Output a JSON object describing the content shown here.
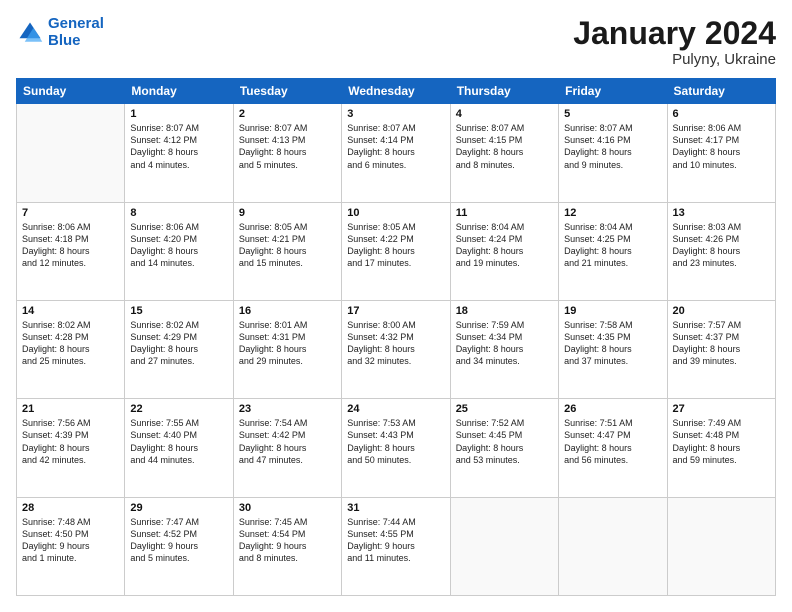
{
  "logo": {
    "line1": "General",
    "line2": "Blue"
  },
  "title": "January 2024",
  "subtitle": "Pulyny, Ukraine",
  "headers": [
    "Sunday",
    "Monday",
    "Tuesday",
    "Wednesday",
    "Thursday",
    "Friday",
    "Saturday"
  ],
  "weeks": [
    [
      {
        "day": "",
        "info": ""
      },
      {
        "day": "1",
        "info": "Sunrise: 8:07 AM\nSunset: 4:12 PM\nDaylight: 8 hours\nand 4 minutes."
      },
      {
        "day": "2",
        "info": "Sunrise: 8:07 AM\nSunset: 4:13 PM\nDaylight: 8 hours\nand 5 minutes."
      },
      {
        "day": "3",
        "info": "Sunrise: 8:07 AM\nSunset: 4:14 PM\nDaylight: 8 hours\nand 6 minutes."
      },
      {
        "day": "4",
        "info": "Sunrise: 8:07 AM\nSunset: 4:15 PM\nDaylight: 8 hours\nand 8 minutes."
      },
      {
        "day": "5",
        "info": "Sunrise: 8:07 AM\nSunset: 4:16 PM\nDaylight: 8 hours\nand 9 minutes."
      },
      {
        "day": "6",
        "info": "Sunrise: 8:06 AM\nSunset: 4:17 PM\nDaylight: 8 hours\nand 10 minutes."
      }
    ],
    [
      {
        "day": "7",
        "info": "Sunrise: 8:06 AM\nSunset: 4:18 PM\nDaylight: 8 hours\nand 12 minutes."
      },
      {
        "day": "8",
        "info": "Sunrise: 8:06 AM\nSunset: 4:20 PM\nDaylight: 8 hours\nand 14 minutes."
      },
      {
        "day": "9",
        "info": "Sunrise: 8:05 AM\nSunset: 4:21 PM\nDaylight: 8 hours\nand 15 minutes."
      },
      {
        "day": "10",
        "info": "Sunrise: 8:05 AM\nSunset: 4:22 PM\nDaylight: 8 hours\nand 17 minutes."
      },
      {
        "day": "11",
        "info": "Sunrise: 8:04 AM\nSunset: 4:24 PM\nDaylight: 8 hours\nand 19 minutes."
      },
      {
        "day": "12",
        "info": "Sunrise: 8:04 AM\nSunset: 4:25 PM\nDaylight: 8 hours\nand 21 minutes."
      },
      {
        "day": "13",
        "info": "Sunrise: 8:03 AM\nSunset: 4:26 PM\nDaylight: 8 hours\nand 23 minutes."
      }
    ],
    [
      {
        "day": "14",
        "info": "Sunrise: 8:02 AM\nSunset: 4:28 PM\nDaylight: 8 hours\nand 25 minutes."
      },
      {
        "day": "15",
        "info": "Sunrise: 8:02 AM\nSunset: 4:29 PM\nDaylight: 8 hours\nand 27 minutes."
      },
      {
        "day": "16",
        "info": "Sunrise: 8:01 AM\nSunset: 4:31 PM\nDaylight: 8 hours\nand 29 minutes."
      },
      {
        "day": "17",
        "info": "Sunrise: 8:00 AM\nSunset: 4:32 PM\nDaylight: 8 hours\nand 32 minutes."
      },
      {
        "day": "18",
        "info": "Sunrise: 7:59 AM\nSunset: 4:34 PM\nDaylight: 8 hours\nand 34 minutes."
      },
      {
        "day": "19",
        "info": "Sunrise: 7:58 AM\nSunset: 4:35 PM\nDaylight: 8 hours\nand 37 minutes."
      },
      {
        "day": "20",
        "info": "Sunrise: 7:57 AM\nSunset: 4:37 PM\nDaylight: 8 hours\nand 39 minutes."
      }
    ],
    [
      {
        "day": "21",
        "info": "Sunrise: 7:56 AM\nSunset: 4:39 PM\nDaylight: 8 hours\nand 42 minutes."
      },
      {
        "day": "22",
        "info": "Sunrise: 7:55 AM\nSunset: 4:40 PM\nDaylight: 8 hours\nand 44 minutes."
      },
      {
        "day": "23",
        "info": "Sunrise: 7:54 AM\nSunset: 4:42 PM\nDaylight: 8 hours\nand 47 minutes."
      },
      {
        "day": "24",
        "info": "Sunrise: 7:53 AM\nSunset: 4:43 PM\nDaylight: 8 hours\nand 50 minutes."
      },
      {
        "day": "25",
        "info": "Sunrise: 7:52 AM\nSunset: 4:45 PM\nDaylight: 8 hours\nand 53 minutes."
      },
      {
        "day": "26",
        "info": "Sunrise: 7:51 AM\nSunset: 4:47 PM\nDaylight: 8 hours\nand 56 minutes."
      },
      {
        "day": "27",
        "info": "Sunrise: 7:49 AM\nSunset: 4:48 PM\nDaylight: 8 hours\nand 59 minutes."
      }
    ],
    [
      {
        "day": "28",
        "info": "Sunrise: 7:48 AM\nSunset: 4:50 PM\nDaylight: 9 hours\nand 1 minute."
      },
      {
        "day": "29",
        "info": "Sunrise: 7:47 AM\nSunset: 4:52 PM\nDaylight: 9 hours\nand 5 minutes."
      },
      {
        "day": "30",
        "info": "Sunrise: 7:45 AM\nSunset: 4:54 PM\nDaylight: 9 hours\nand 8 minutes."
      },
      {
        "day": "31",
        "info": "Sunrise: 7:44 AM\nSunset: 4:55 PM\nDaylight: 9 hours\nand 11 minutes."
      },
      {
        "day": "",
        "info": ""
      },
      {
        "day": "",
        "info": ""
      },
      {
        "day": "",
        "info": ""
      }
    ]
  ]
}
